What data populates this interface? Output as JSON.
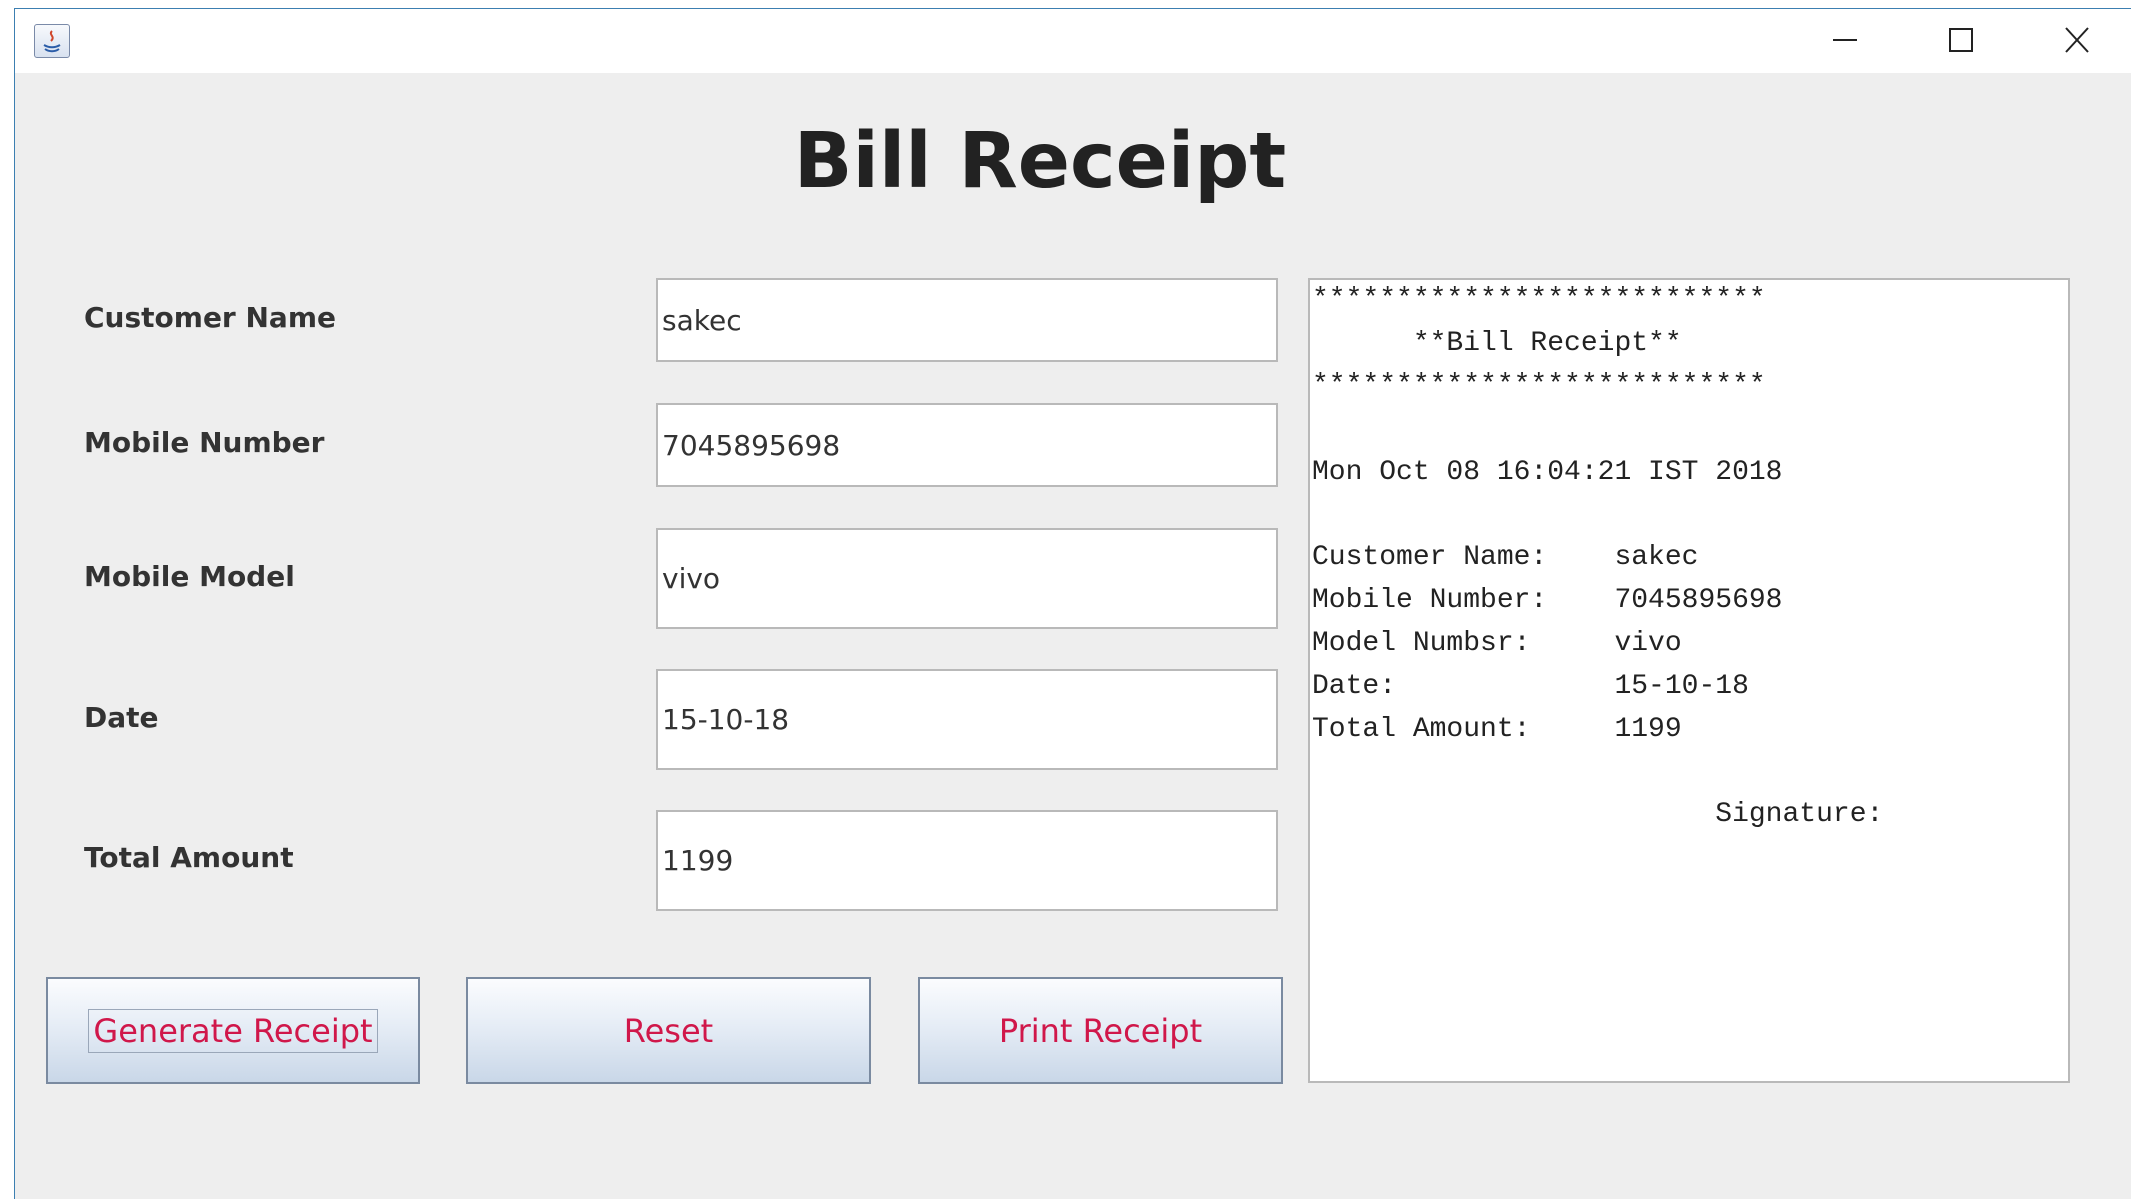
{
  "heading": "Bill Receipt",
  "form": {
    "customer_name": {
      "label": "Customer Name",
      "value": "sakec"
    },
    "mobile_number": {
      "label": "Mobile Number",
      "value": "7045895698"
    },
    "mobile_model": {
      "label": "Mobile Model",
      "value": "vivo"
    },
    "date": {
      "label": "Date",
      "value": "15-10-18"
    },
    "total_amount": {
      "label": "Total Amount",
      "value": "1199"
    }
  },
  "buttons": {
    "generate": "Generate Receipt",
    "reset": "Reset",
    "print": "Print Receipt"
  },
  "receipt": {
    "stars_top": "***************************",
    "title": "      **Bill Receipt**",
    "stars_bottom": "***************************",
    "timestamp": "Mon Oct 08 16:04:21 IST 2018",
    "line_customer": "Customer Name:    sakec",
    "line_mobile": "Mobile Number:    7045895698",
    "line_model": "Model Numbsr:     vivo",
    "line_date": "Date:             15-10-18",
    "line_total": "Total Amount:     1199",
    "signature": "                        Signature:"
  },
  "colors": {
    "button_text": "#d0174a",
    "window_bg": "#eeeeee",
    "window_border": "#3c7fb1"
  },
  "icons": {
    "app": "java-app-icon",
    "minimize": "minimize-icon",
    "maximize": "maximize-icon",
    "close": "close-icon"
  }
}
